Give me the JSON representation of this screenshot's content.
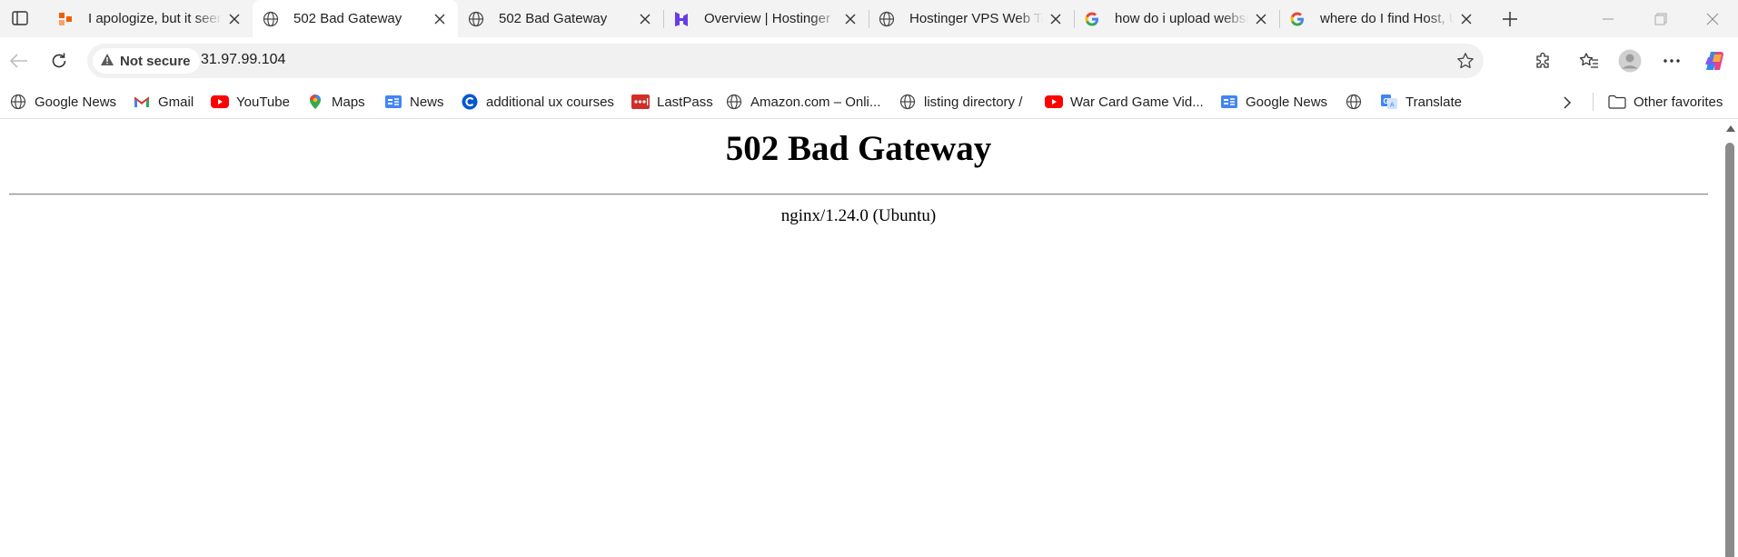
{
  "browser": {
    "tabs": [
      {
        "title": "I apologize, but it seems",
        "favicon": "orange-squares-icon",
        "active": false
      },
      {
        "title": "502 Bad Gateway",
        "favicon": "globe-icon",
        "active": true
      },
      {
        "title": "502 Bad Gateway",
        "favicon": "globe-icon",
        "active": false
      },
      {
        "title": "Overview | Hostinger",
        "favicon": "hostinger-icon",
        "active": false
      },
      {
        "title": "Hostinger VPS Web Terminal",
        "favicon": "globe-icon",
        "active": false
      },
      {
        "title": "how do i upload website",
        "favicon": "google-icon",
        "active": false
      },
      {
        "title": "where do I find Host, U",
        "favicon": "google-icon",
        "active": false
      }
    ],
    "address": {
      "security_label": "Not secure",
      "url": "31.97.99.104"
    },
    "bookmarks": [
      {
        "label": "Google News",
        "icon": "globe-icon"
      },
      {
        "label": "Gmail",
        "icon": "gmail-icon"
      },
      {
        "label": "YouTube",
        "icon": "youtube-icon"
      },
      {
        "label": "Maps",
        "icon": "maps-pin-icon"
      },
      {
        "label": "News",
        "icon": "google-news-icon"
      },
      {
        "label": "additional ux courses",
        "icon": "coursera-icon"
      },
      {
        "label": "LastPass",
        "icon": "lastpass-icon"
      },
      {
        "label": "Amazon.com – Onli...",
        "icon": "globe-icon"
      },
      {
        "label": "listing directory /",
        "icon": "globe-icon"
      },
      {
        "label": "War Card Game Vid...",
        "icon": "youtube-icon"
      },
      {
        "label": "Google News",
        "icon": "google-news-icon"
      },
      {
        "label": "",
        "icon": "globe-icon"
      },
      {
        "label": "Translate",
        "icon": "translate-icon"
      }
    ],
    "other_favorites": "Other favorites",
    "colors": {
      "accent_orange": "#f25c05",
      "youtube_red": "#ff0000",
      "hostinger_purple": "#673de6",
      "lastpass_red": "#d32d27"
    }
  },
  "page": {
    "heading": "502 Bad Gateway",
    "server": "nginx/1.24.0 (Ubuntu)"
  }
}
